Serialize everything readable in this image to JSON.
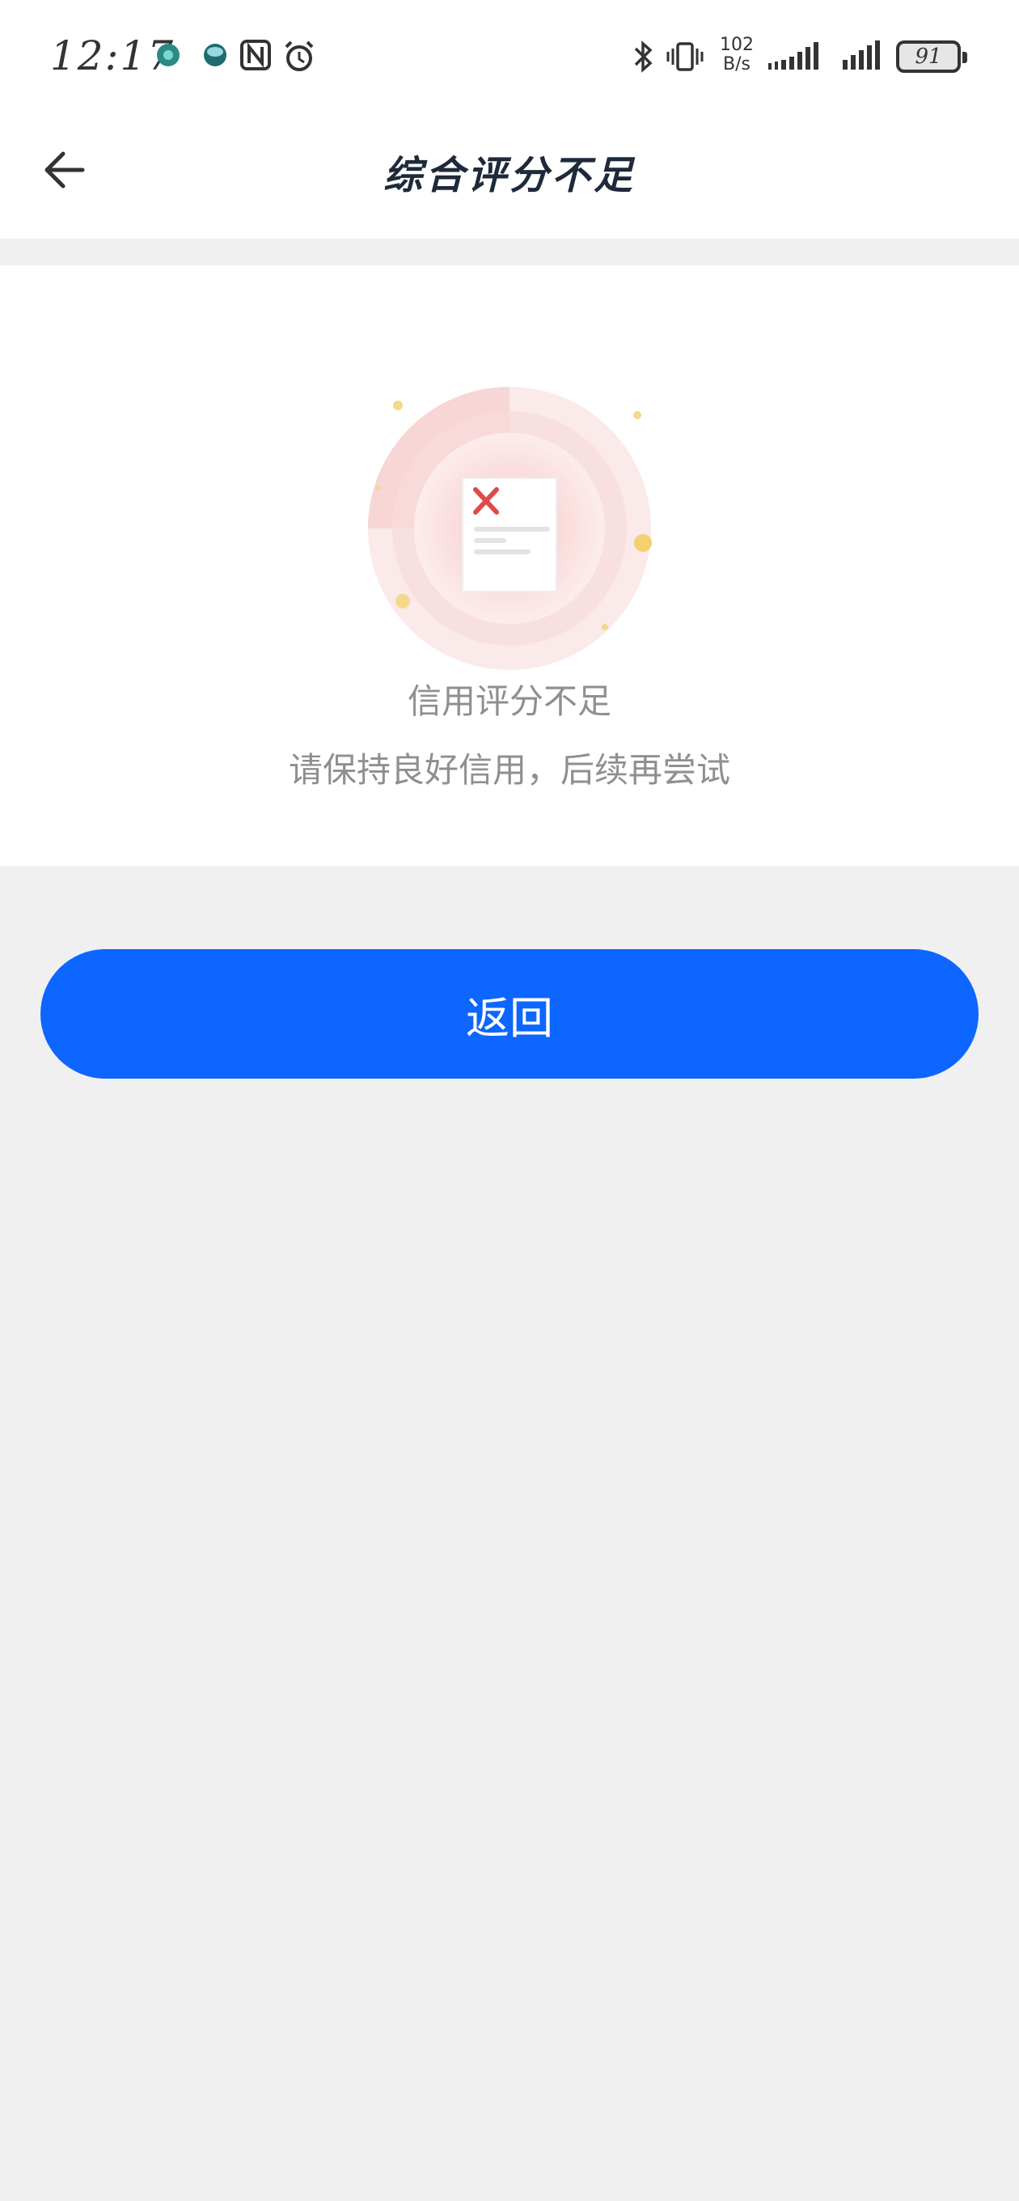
{
  "status_bar": {
    "time": "12:17",
    "net_speed_value": "102",
    "net_speed_unit": "B/s",
    "battery": "91",
    "icons": [
      "app-notification-icon",
      "app-notification-icon",
      "nfc-icon",
      "alarm-icon",
      "bluetooth-icon",
      "vibrate-icon",
      "signal-icon",
      "signal-icon"
    ]
  },
  "nav": {
    "back_icon": "arrow-left-icon",
    "title": "综合评分不足"
  },
  "result": {
    "illustration_icon": "rejected-document-icon",
    "title": "信用评分不足",
    "subtitle": "请保持良好信用，后续再尝试"
  },
  "actions": {
    "return_label": "返回"
  },
  "colors": {
    "accent": "#0d66ff",
    "page_bg": "#f0f0f0",
    "error": "#e04a4a"
  }
}
